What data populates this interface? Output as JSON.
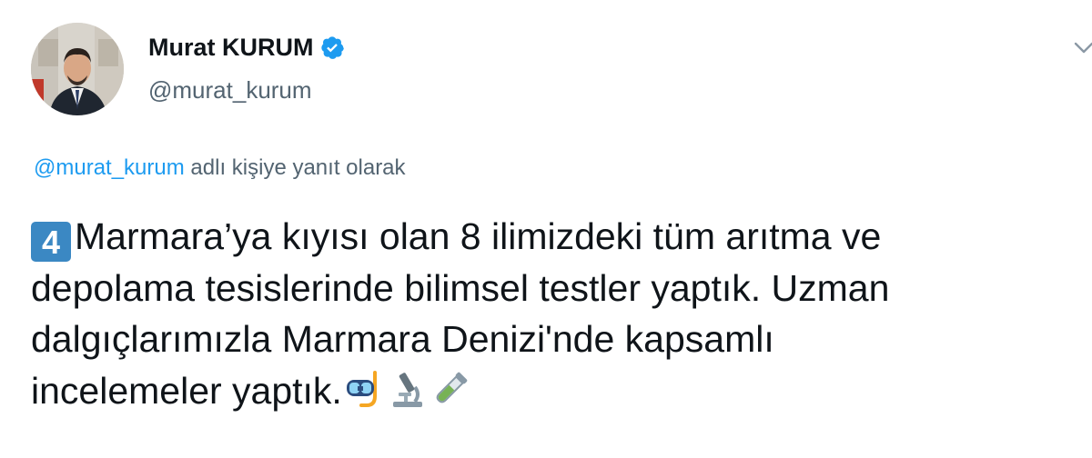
{
  "author": {
    "display_name": "Murat KURUM",
    "handle": "@murat_kurum",
    "verified": true,
    "verified_color": "#1d9bf0"
  },
  "reply": {
    "handle": "@murat_kurum",
    "text": " adlı kişiye yanıt olarak"
  },
  "tweet": {
    "keycap": "4",
    "lines": [
      "Marmara’ya kıyısı olan 8 ilimizdeki tüm arıtma ve",
      "depolama tesislerinde bilimsel testler yaptık. Uzman",
      "dalgıçlarımızla Marmara Denizi'nde kapsamlı",
      "incelemeler yaptık."
    ],
    "emojis": [
      "diving-mask-icon",
      "microscope-icon",
      "test-tube-icon"
    ]
  },
  "colors": {
    "link": "#1d9bf0",
    "text": "#0f1419",
    "muted": "#536471",
    "keycap": "#3b88c3"
  }
}
